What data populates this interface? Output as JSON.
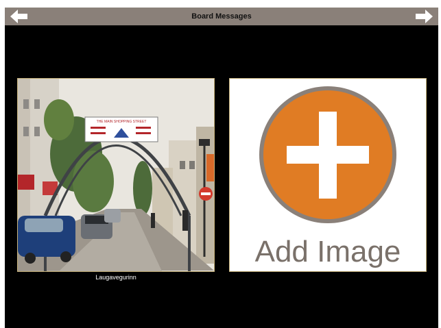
{
  "topbar": {
    "title": "Board Messages",
    "back_icon": "arrow-left-icon",
    "forward_icon": "arrow-right-icon"
  },
  "photo_card": {
    "caption": "Laugavegurinn",
    "banner_line": "THE MAIN SHOPPING STREET"
  },
  "add_card": {
    "label": "Add Image",
    "icon": "plus-circle-icon",
    "accent": "#e07c24",
    "ring": "#8a8079"
  },
  "colors": {
    "topbar": "#8a8079",
    "background": "#000000",
    "card_border": "#c7b27a"
  }
}
